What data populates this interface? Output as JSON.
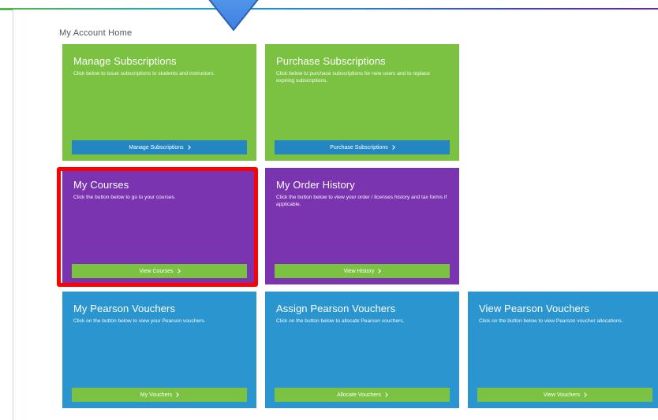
{
  "page": {
    "title": "My Account Home"
  },
  "colors": {
    "green": "#7cc242",
    "purple": "#7a34b0",
    "blue": "#2b95cf",
    "button_blue": "#2486c1",
    "highlight": "#ff0000"
  },
  "tiles": [
    {
      "title": "Manage Subscriptions",
      "desc": "Click below to issue subscriptions to students and instructors.",
      "button": "Manage Subscriptions"
    },
    {
      "title": "Purchase Subscriptions",
      "desc": "Click below to purchase subscriptions for new users and to replace expiring subscriptions.",
      "button": "Purchase Subscriptions"
    },
    {
      "title": "My Courses",
      "desc": "Click the button below to go to your courses.",
      "button": "View Courses"
    },
    {
      "title": "My Order History",
      "desc": "Click the button below to view your order / licenses history and tax forms if applicable.",
      "button": "View History"
    },
    {
      "title": "My Pearson Vouchers",
      "desc": "Click on the button below to view your Pearson vouchers.",
      "button": "My Vouchers"
    },
    {
      "title": "Assign Pearson Vouchers",
      "desc": "Click on the button below to allocate Pearson vouchers.",
      "button": "Allocate Vouchers"
    },
    {
      "title": "View Pearson Vouchers",
      "desc": "Click on the button below to view Pearson voucher allocations.",
      "button": "View Vouchers"
    }
  ]
}
